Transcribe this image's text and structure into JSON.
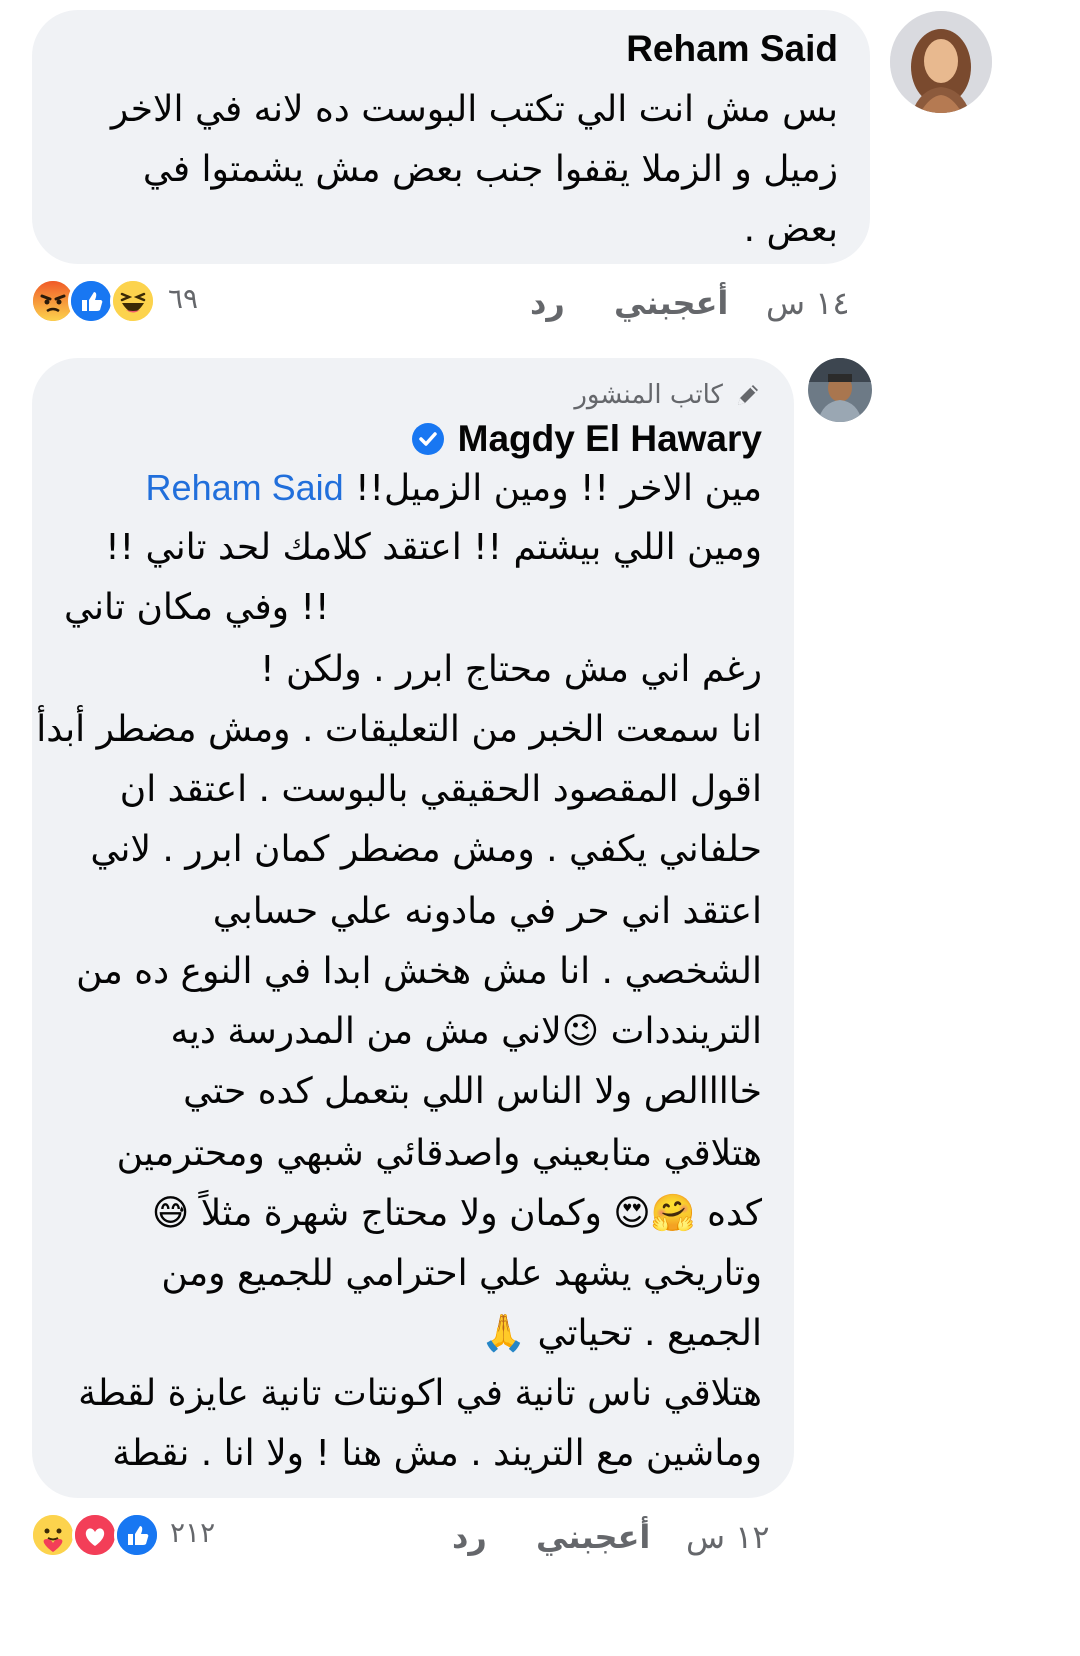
{
  "comment1": {
    "author": "Reham Said",
    "lines": [
      "بس مش انت الي تكتب البوست ده لانه في الاخر",
      "زميل و الزملا يقفوا جنب بعض مش يشمتوا في",
      "بعض ."
    ],
    "time": "١٤ س",
    "like_label": "أعجبني",
    "reply_label": "رد",
    "reaction_count": "٦٩",
    "reactions": [
      "angry-reaction-icon",
      "like-reaction-icon",
      "haha-reaction-icon"
    ]
  },
  "comment2": {
    "author_role": "كاتب المنشور",
    "author": "Magdy El Hawary",
    "verified": true,
    "mention": "Reham Said",
    "first_line_text": "مين الاخر !! ومين الزميل!!",
    "lines": [
      "ومين اللي بيشتم !! اعتقد كلامك لحد تاني !!",
      "!! وفي مكان تاني",
      "رغم اني مش محتاج ابرر . ولكن !",
      "انا سمعت الخبر من التعليقات . ومش مضطر أبدأ",
      "اقول المقصود الحقيقي بالبوست . اعتقد ان",
      "حلفاني يكفي . ومش مضطر كمان ابرر . لاني",
      "اعتقد اني حر في مادونه علي حسابي",
      "الشخصي . انا مش هخش ابدا في النوع ده من",
      "الترينددات 😉لاني مش من المدرسة ديه",
      "خاااالص ولا الناس اللي بتعمل كده حتي",
      "هتلاقي متابعيني واصدقائي شبهي ومحترمين",
      "كده 🤗😍 وكمان ولا محتاج شهرة مثلاً 😅",
      "وتاريخي يشهد علي احترامي للجميع ومن",
      "الجميع . تحياتي 🙏",
      "هتلاقي ناس تانية في اكونتات تانية عايزة لقطة",
      "وماشين مع التريند . مش هنا ! ولا انا . نقطة"
    ],
    "time": "١٢ س",
    "like_label": "أعجبني",
    "reply_label": "رد",
    "reaction_count": "٢١٢",
    "reactions": [
      "care-reaction-icon",
      "love-reaction-icon",
      "like-reaction-icon"
    ]
  },
  "colors": {
    "bubble": "#f0f2f5",
    "meta_text": "#65676b",
    "mention": "#216fdb",
    "like_blue": "#1877f2",
    "love_red": "#f33e58",
    "reaction_yellow": "#fcd34d",
    "angry_orange": "#e9710f"
  }
}
